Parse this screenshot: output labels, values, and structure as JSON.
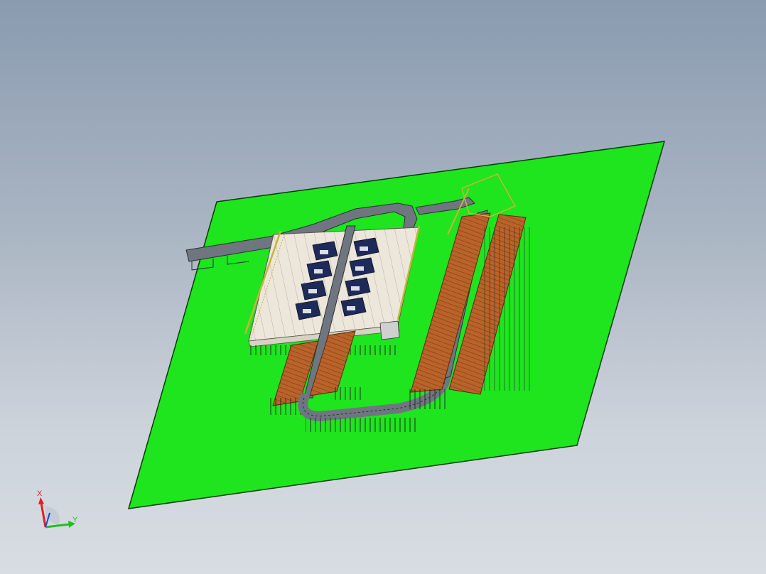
{
  "viewport": {
    "background_top": "#8a9bb0",
    "background_bottom": "#d8dde3"
  },
  "model": {
    "ground_color": "#1ee51e",
    "conveyor_color": "#6f7680",
    "rack_color": "#b9632a",
    "platform_color": "#e9e4d6",
    "railing_color": "#c8b43a",
    "machine_color": "#1e2a5a"
  },
  "triad": {
    "x_label": "X",
    "y_label": "Y",
    "x_color": "#e02020",
    "y_color": "#20c020",
    "z_color": "#2040e0"
  }
}
